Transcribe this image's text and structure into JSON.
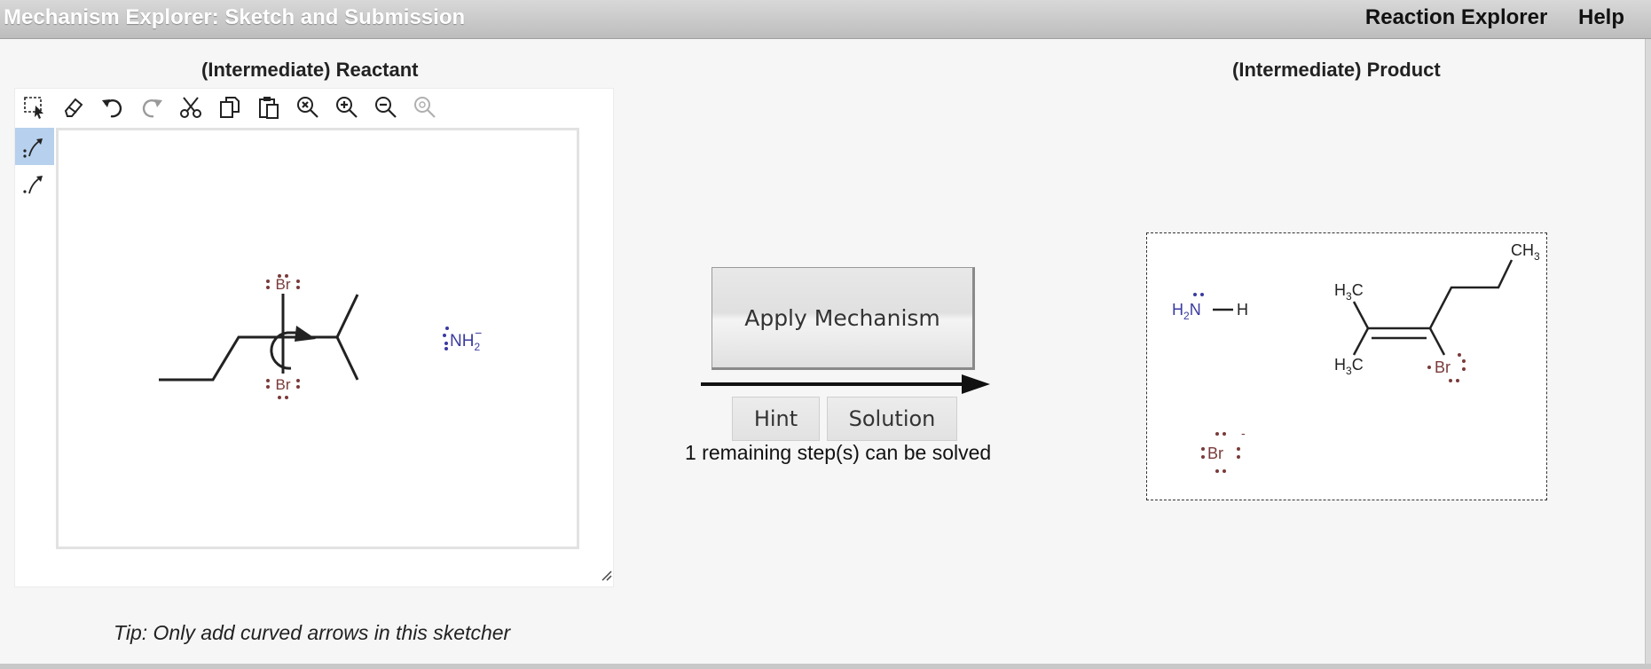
{
  "app": {
    "title": "Mechanism Explorer: Sketch and Submission",
    "nav": [
      "Reaction Explorer",
      "Help"
    ]
  },
  "reactant_panel": {
    "heading": "(Intermediate) Reactant",
    "toolbar_icons": [
      "select-icon",
      "eraser-icon",
      "undo-icon",
      "redo-icon",
      "cut-icon",
      "copy-icon",
      "paste-icon",
      "zoom-fit-icon",
      "zoom-in-icon",
      "zoom-out-icon",
      "zoom-reset-icon"
    ],
    "tools": [
      {
        "icon": "electron-pair-arrow-icon",
        "active": true
      },
      {
        "icon": "single-electron-arrow-icon",
        "active": false
      }
    ],
    "molecule": {
      "br_top": "Br",
      "br_bottom": "Br",
      "amide": "NH",
      "amide_sub": "2",
      "amide_charge": "−"
    },
    "tip": "Tip: Only add curved arrows in this sketcher"
  },
  "controls": {
    "apply_label": "Apply Mechanism",
    "hint_label": "Hint",
    "solution_label": "Solution",
    "status": "1 remaining step(s) can be solved"
  },
  "product_panel": {
    "heading": "(Intermediate) Product",
    "molecule": {
      "amine_h": "H",
      "amine_sub": "2",
      "amine_n": "N",
      "amine_h2": "H",
      "ch3_top": "CH",
      "ch3_sub": "3",
      "h3c_a": "H",
      "h3c_a_sub": "3",
      "h3c_a_c": "C",
      "h3c_b": "H",
      "h3c_b_sub": "3",
      "h3c_b_c": "C",
      "br_attached": "Br",
      "br_ion": "Br",
      "br_ion_charge": "-"
    }
  },
  "colors": {
    "bromine": "#7a3a3a",
    "nitrogen": "#3a3aa0",
    "active_tool": "#b6d0ee"
  }
}
